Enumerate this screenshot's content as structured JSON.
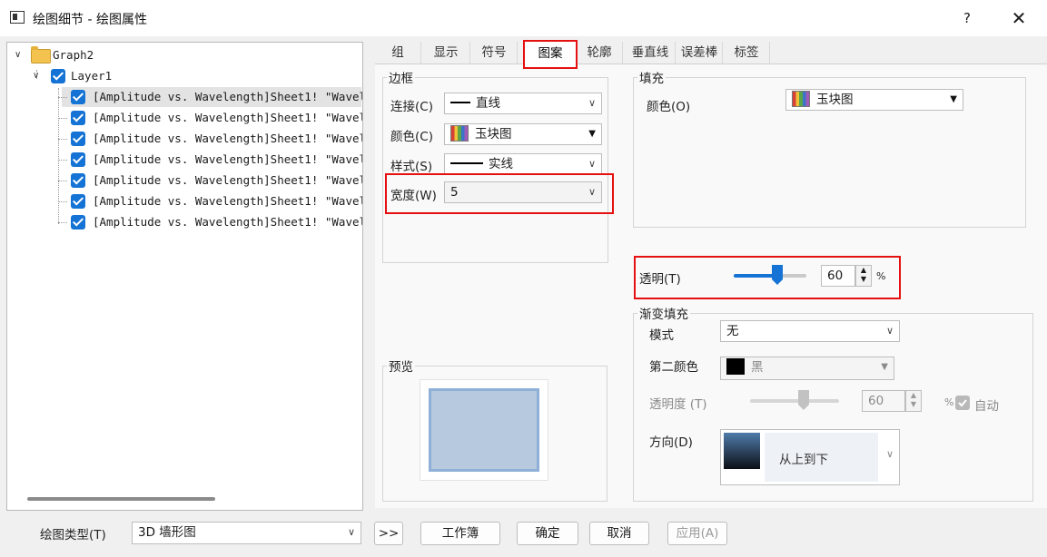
{
  "window": {
    "title": "绘图细节 - 绘图属性",
    "help": "?",
    "close": "✕"
  },
  "tree": {
    "root": "Graph2",
    "layer": "Layer1",
    "plots": [
      "[Amplitude vs. Wavelength]Sheet1! \"Wavel",
      "[Amplitude vs. Wavelength]Sheet1! \"Wavel",
      "[Amplitude vs. Wavelength]Sheet1! \"Wavel",
      "[Amplitude vs. Wavelength]Sheet1! \"Wavel",
      "[Amplitude vs. Wavelength]Sheet1! \"Wavel",
      "[Amplitude vs. Wavelength]Sheet1! \"Wavel",
      "[Amplitude vs. Wavelength]Sheet1! \"Wavel"
    ]
  },
  "tabs": [
    "组",
    "显示",
    "符号",
    "图案",
    "轮廓",
    "垂直线",
    "误差棒",
    "标签"
  ],
  "active_tab": "图案",
  "border": {
    "title": "边框",
    "connect_label": "连接(C)",
    "connect_value": "直线",
    "color_label": "颜色(C)",
    "color_value": "玉块图",
    "style_label": "样式(S)",
    "style_value": "实线",
    "width_label": "宽度(W)",
    "width_value": "5"
  },
  "fill": {
    "title": "填充",
    "color_label": "颜色(O)",
    "color_value": "玉块图"
  },
  "transparency": {
    "label": "透明(T)",
    "value": "60",
    "unit": "%",
    "level_percent": 60
  },
  "gradient": {
    "title": "渐变填充",
    "mode_label": "模式",
    "mode_value": "无",
    "second_color_label": "第二颜色",
    "second_color_value": "黑",
    "opacity_label": "透明度 (T)",
    "opacity_value": "60",
    "opacity_unit": "%",
    "auto_label": "自动",
    "direction_label": "方向(D)",
    "direction_value": "从上到下"
  },
  "preview": {
    "title": "预览"
  },
  "footer": {
    "plot_type_label": "绘图类型(T)",
    "plot_type_value": "3D 墙形图",
    "more": ">>",
    "workbook": "工作簿",
    "ok": "确定",
    "cancel": "取消",
    "apply": "应用(A)"
  },
  "colors": {
    "accent": "#1473d4",
    "highlight": "#e5100f",
    "preview_fill": "#b7c9df",
    "preview_border": "#8fb0d6"
  }
}
